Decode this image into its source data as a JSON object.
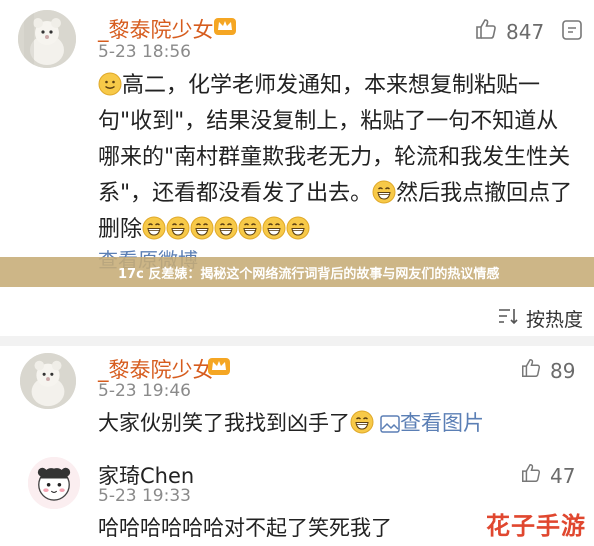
{
  "comment1": {
    "author": "_黎泰院少女",
    "time": "5-23 18:56",
    "likes": "847",
    "text_parts": {
      "p1": "高二，化学老师发通知，本来想复制粘贴一句\"收到\"，结果没复制上，粘贴了一句不知道从哪来的\"南村群童欺我老无力，轮流和我发生性关系\"，还看都没看发了出去。",
      "p2": "然后我点撤回点了删除"
    },
    "view_original": "查看原微博"
  },
  "banner": {
    "text": "17c 反差婊：揭秘这个网络流行词背后的故事与网友们的热议情感"
  },
  "sort": {
    "label": "按热度"
  },
  "reply1": {
    "author": "_黎泰院少女",
    "time": "5-23 19:46",
    "likes": "89",
    "text": "大家伙别笑了我找到凶手了",
    "link": "查看图片"
  },
  "reply2": {
    "author": "家琦Chen",
    "time": "5-23 19:33",
    "likes": "47",
    "text": "哈哈哈哈哈哈对不起了笑死我了"
  },
  "watermark": {
    "text": "花子手游"
  },
  "colors": {
    "name": "#d65c1e",
    "link": "#5b7fb5",
    "banner": "#c6ac76"
  }
}
